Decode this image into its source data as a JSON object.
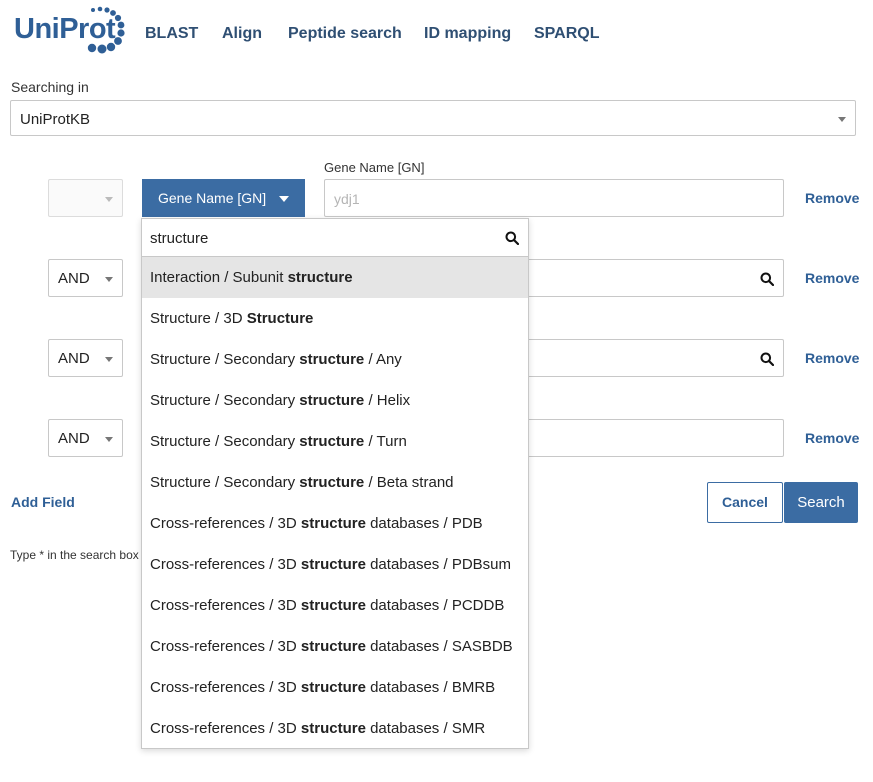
{
  "brand": {
    "logo_text": "UniProt",
    "color": "#2f5f96"
  },
  "nav": [
    {
      "label": "BLAST"
    },
    {
      "label": "Align"
    },
    {
      "label": "Peptide search"
    },
    {
      "label": "ID mapping"
    },
    {
      "label": "SPARQL"
    }
  ],
  "searching_in": {
    "label": "Searching in",
    "value": "UniProtKB"
  },
  "rows": [
    {
      "operator": "",
      "field_label": "Gene Name [GN]",
      "field_button": "Gene Name [GN]",
      "placeholder": "ydj1",
      "remove": "Remove"
    },
    {
      "operator": "AND",
      "remove": "Remove"
    },
    {
      "operator": "AND",
      "remove": "Remove"
    },
    {
      "operator": "AND",
      "remove": "Remove"
    }
  ],
  "dropdown": {
    "search_value": "structure",
    "items": [
      {
        "pre": "Interaction / Subunit ",
        "bold": "structure",
        "post": ""
      },
      {
        "pre": "Structure / 3D ",
        "bold": "Structure",
        "post": ""
      },
      {
        "pre": "Structure / Secondary ",
        "bold": "structure",
        "post": " / Any"
      },
      {
        "pre": "Structure / Secondary ",
        "bold": "structure",
        "post": " / Helix"
      },
      {
        "pre": "Structure / Secondary ",
        "bold": "structure",
        "post": " / Turn"
      },
      {
        "pre": "Structure / Secondary ",
        "bold": "structure",
        "post": " / Beta strand"
      },
      {
        "pre": "Cross-references / 3D ",
        "bold": "structure",
        "post": " databases / PDB"
      },
      {
        "pre": "Cross-references / 3D ",
        "bold": "structure",
        "post": " databases / PDBsum"
      },
      {
        "pre": "Cross-references / 3D ",
        "bold": "structure",
        "post": " databases / PCDDB"
      },
      {
        "pre": "Cross-references / 3D ",
        "bold": "structure",
        "post": " databases / SASBDB"
      },
      {
        "pre": "Cross-references / 3D ",
        "bold": "structure",
        "post": " databases / BMRB"
      },
      {
        "pre": "Cross-references / 3D ",
        "bold": "structure",
        "post": " databases / SMR"
      }
    ]
  },
  "add_field": "Add Field",
  "hint": "Type * in the search box",
  "actions": {
    "cancel": "Cancel",
    "search": "Search"
  },
  "colors": {
    "primary": "#3b6ca3",
    "link": "#2f5f96"
  },
  "icons": {
    "search": "search-icon",
    "logo": "uniprot-logo"
  }
}
